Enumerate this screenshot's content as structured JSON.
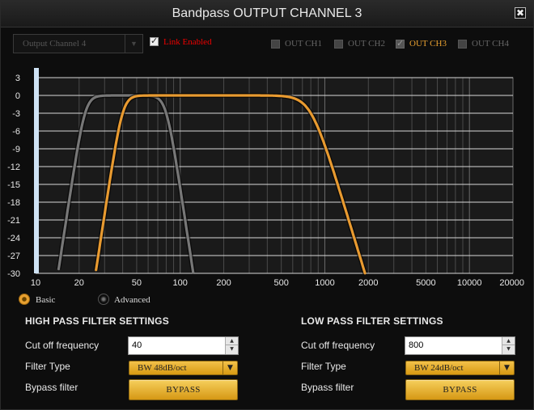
{
  "window": {
    "title": "Bandpass OUTPUT CHANNEL 3",
    "close_glyph": "✖"
  },
  "topbar": {
    "channel_select": "Output Channel 4",
    "link_enabled_label": "Link Enabled",
    "link_enabled_checked": true,
    "outputs": [
      {
        "label": "OUT CH1",
        "checked": false,
        "active": false
      },
      {
        "label": "OUT CH2",
        "checked": false,
        "active": false
      },
      {
        "label": "OUT CH3",
        "checked": true,
        "active": true
      },
      {
        "label": "OUT CH4",
        "checked": false,
        "active": false
      }
    ]
  },
  "chart_data": {
    "type": "line",
    "title": "",
    "xscale": "log",
    "xlim": [
      10,
      20000
    ],
    "ylim": [
      -30,
      3
    ],
    "x_ticks": [
      "10",
      "20",
      "50",
      "100",
      "200",
      "500",
      "1000",
      "2000",
      "5000",
      "10000",
      "20000"
    ],
    "y_ticks": [
      "3",
      "0",
      "-3",
      "-6",
      "-9",
      "-12",
      "-15",
      "-18",
      "-21",
      "-24",
      "-27",
      "-30"
    ],
    "grid": true,
    "series": [
      {
        "color": "#777777",
        "hp_freq": 22,
        "hp_order": 8,
        "lp_freq": 80,
        "lp_order": 8
      },
      {
        "color": "#e89a30",
        "hp_freq": 40,
        "hp_order": 8,
        "lp_freq": 800,
        "lp_order": 4
      }
    ]
  },
  "mode": {
    "basic_label": "Basic",
    "advanced_label": "Advanced",
    "selected": "Basic"
  },
  "high_pass": {
    "heading": "HIGH PASS FILTER SETTINGS",
    "cutoff_label": "Cut off frequency",
    "cutoff_value": "40",
    "filter_type_label": "Filter Type",
    "filter_type_value": "BW 48dB/oct",
    "bypass_label": "Bypass filter",
    "bypass_button": "BYPASS"
  },
  "low_pass": {
    "heading": "LOW PASS FILTER SETTINGS",
    "cutoff_label": "Cut off frequency",
    "cutoff_value": "800",
    "filter_type_label": "Filter Type",
    "filter_type_value": "BW 24dB/oct",
    "bypass_label": "Bypass filter",
    "bypass_button": "BYPASS"
  }
}
